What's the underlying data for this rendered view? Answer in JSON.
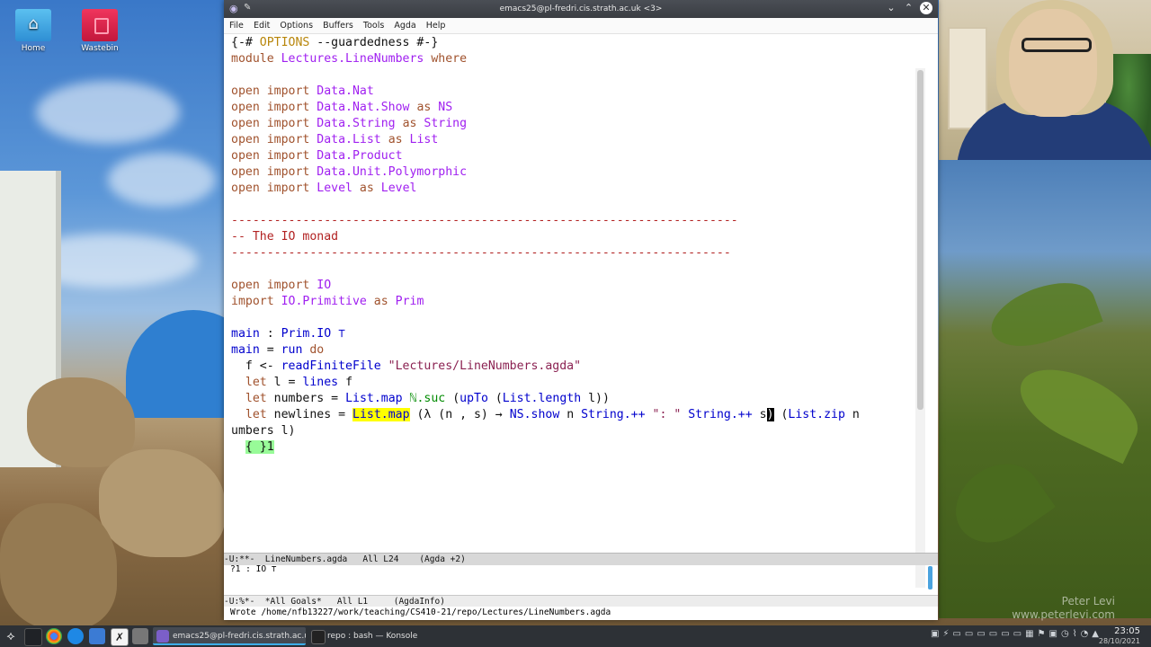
{
  "desktop": {
    "icons": [
      {
        "label": "Home"
      },
      {
        "label": "Wastebin"
      }
    ],
    "watermark": [
      "Peter Levi",
      "www.peterlevi.com"
    ]
  },
  "window": {
    "title": "emacs25@pl-fredri.cis.strath.ac.uk <3>",
    "menu": [
      "File",
      "Edit",
      "Options",
      "Buffers",
      "Tools",
      "Agda",
      "Help"
    ]
  },
  "editor": {
    "lines": [
      {
        "segs": [
          {
            "t": "{-# ",
            "c": "plain"
          },
          {
            "t": "OPTIONS",
            "c": "kw2"
          },
          {
            "t": " --guardedness #-}",
            "c": "plain"
          }
        ]
      },
      {
        "segs": [
          {
            "t": "module ",
            "c": "kw"
          },
          {
            "t": "Lectures.LineNumbers",
            "c": "mod"
          },
          {
            "t": " where",
            "c": "kw"
          }
        ]
      },
      {
        "segs": []
      },
      {
        "segs": [
          {
            "t": "open import ",
            "c": "kw"
          },
          {
            "t": "Data.Nat",
            "c": "mod"
          }
        ]
      },
      {
        "segs": [
          {
            "t": "open import ",
            "c": "kw"
          },
          {
            "t": "Data.Nat.Show",
            "c": "mod"
          },
          {
            "t": " as ",
            "c": "kw"
          },
          {
            "t": "NS",
            "c": "mod"
          }
        ]
      },
      {
        "segs": [
          {
            "t": "open import ",
            "c": "kw"
          },
          {
            "t": "Data.String",
            "c": "mod"
          },
          {
            "t": " as ",
            "c": "kw"
          },
          {
            "t": "String",
            "c": "mod"
          }
        ]
      },
      {
        "segs": [
          {
            "t": "open import ",
            "c": "kw"
          },
          {
            "t": "Data.List",
            "c": "mod"
          },
          {
            "t": " as ",
            "c": "kw"
          },
          {
            "t": "List",
            "c": "mod"
          }
        ]
      },
      {
        "segs": [
          {
            "t": "open import ",
            "c": "kw"
          },
          {
            "t": "Data.Product",
            "c": "mod"
          }
        ]
      },
      {
        "segs": [
          {
            "t": "open import ",
            "c": "kw"
          },
          {
            "t": "Data.Unit.Polymorphic",
            "c": "mod"
          }
        ]
      },
      {
        "segs": [
          {
            "t": "open import ",
            "c": "kw"
          },
          {
            "t": "Level",
            "c": "mod"
          },
          {
            "t": " as ",
            "c": "kw"
          },
          {
            "t": "Level",
            "c": "mod"
          }
        ]
      },
      {
        "segs": []
      },
      {
        "segs": [
          {
            "t": "-----------------------------------------------------------------------",
            "c": "cmt"
          }
        ]
      },
      {
        "segs": [
          {
            "t": "-- The IO monad",
            "c": "cmt"
          }
        ]
      },
      {
        "segs": [
          {
            "t": "----------------------------------------------------------------------",
            "c": "cmt"
          }
        ]
      },
      {
        "segs": []
      },
      {
        "segs": [
          {
            "t": "open import ",
            "c": "kw"
          },
          {
            "t": "IO",
            "c": "mod"
          }
        ]
      },
      {
        "segs": [
          {
            "t": "import ",
            "c": "kw"
          },
          {
            "t": "IO.Primitive",
            "c": "mod"
          },
          {
            "t": " as ",
            "c": "kw"
          },
          {
            "t": "Prim",
            "c": "mod"
          }
        ]
      },
      {
        "segs": []
      },
      {
        "segs": [
          {
            "t": "main",
            "c": "fn"
          },
          {
            "t": " : ",
            "c": "plain"
          },
          {
            "t": "Prim.IO",
            "c": "fn"
          },
          {
            "t": " ⊤",
            "c": "fn"
          }
        ]
      },
      {
        "segs": [
          {
            "t": "main",
            "c": "fn"
          },
          {
            "t": " = ",
            "c": "plain"
          },
          {
            "t": "run",
            "c": "fn"
          },
          {
            "t": " do",
            "c": "kw"
          }
        ]
      },
      {
        "segs": [
          {
            "t": "  f <- ",
            "c": "plain"
          },
          {
            "t": "readFiniteFile",
            "c": "fn"
          },
          {
            "t": " \"Lectures/LineNumbers.agda\"",
            "c": "str"
          }
        ]
      },
      {
        "segs": [
          {
            "t": "  ",
            "c": "plain"
          },
          {
            "t": "let",
            "c": "kw"
          },
          {
            "t": " l = ",
            "c": "plain"
          },
          {
            "t": "lines",
            "c": "fn"
          },
          {
            "t": " f",
            "c": "plain"
          }
        ]
      },
      {
        "segs": [
          {
            "t": "  ",
            "c": "plain"
          },
          {
            "t": "let",
            "c": "kw"
          },
          {
            "t": " numbers = ",
            "c": "plain"
          },
          {
            "t": "List.map",
            "c": "fn"
          },
          {
            "t": " ",
            "c": "plain"
          },
          {
            "t": "ℕ.suc",
            "c": "ctor"
          },
          {
            "t": " (",
            "c": "plain"
          },
          {
            "t": "upTo",
            "c": "fn"
          },
          {
            "t": " (",
            "c": "plain"
          },
          {
            "t": "List.length",
            "c": "fn"
          },
          {
            "t": " l))",
            "c": "plain"
          }
        ]
      },
      {
        "segs": [
          {
            "t": "  ",
            "c": "plain"
          },
          {
            "t": "let",
            "c": "kw"
          },
          {
            "t": " newlines = ",
            "c": "plain"
          },
          {
            "t": "List.map",
            "c": "hl-yellow"
          },
          {
            "t": " (λ (n , s) → ",
            "c": "plain"
          },
          {
            "t": "NS.show",
            "c": "fn"
          },
          {
            "t": " n ",
            "c": "plain"
          },
          {
            "t": "String.++",
            "c": "fn"
          },
          {
            "t": " \": \" ",
            "c": "str"
          },
          {
            "t": "String.++",
            "c": "fn"
          },
          {
            "t": " s",
            "c": "plain"
          },
          {
            "t": ")",
            "c": "cursor"
          },
          {
            "t": " (",
            "c": "plain"
          },
          {
            "t": "List.zip",
            "c": "fn"
          },
          {
            "t": " n",
            "c": "plain"
          }
        ]
      },
      {
        "segs": [
          {
            "t": "umbers l)",
            "c": "plain"
          }
        ]
      },
      {
        "segs": [
          {
            "t": "  ",
            "c": "plain"
          },
          {
            "t": "{ }1",
            "c": "hole"
          }
        ]
      }
    ]
  },
  "modeline_main": "-U:**-  LineNumbers.agda   All L24    (Agda +2)",
  "goals_line": "?1 : IO ⊤",
  "modeline_goals": "-U:%*-  *All Goals*   All L1     (AgdaInfo)",
  "echo": "Wrote /home/nfb13227/work/teaching/CS410-21/repo/Lectures/LineNumbers.agda",
  "taskbar": {
    "tasks": [
      {
        "label": "emacs25@pl-fredri.cis.strath.ac.uk..."
      },
      {
        "label": "repo : bash — Konsole"
      }
    ],
    "time": "23:05",
    "date": "28/10/2021"
  },
  "colors": {
    "accent": "#3daee9",
    "keyword": "#a0522d",
    "module": "#a020f0",
    "function": "#0000cd",
    "string": "#8b2252",
    "comment": "#b22222",
    "hole": "#98fb98"
  }
}
